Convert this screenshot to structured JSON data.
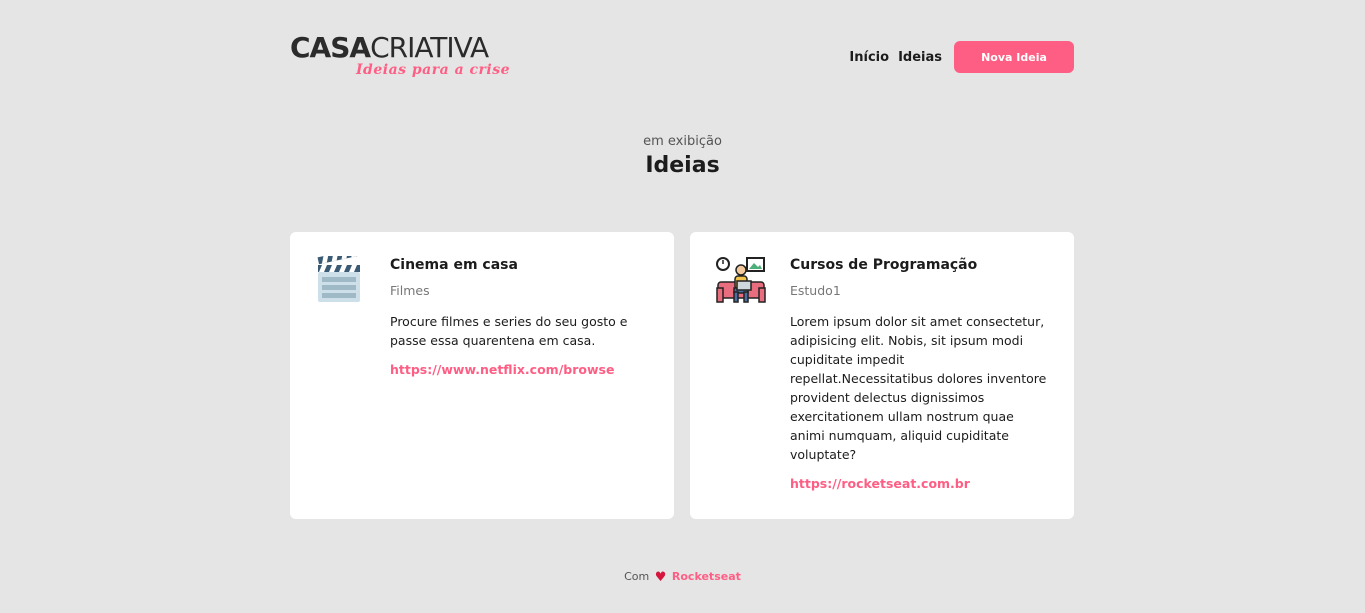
{
  "header": {
    "logo": {
      "main_bold": "CASA",
      "main_light": "CRIATIVA",
      "tagline": "Ideias para a crise"
    },
    "nav": {
      "items": [
        {
          "label": "Início"
        },
        {
          "label": "Ideias"
        }
      ],
      "button_label": "Nova Ideia"
    }
  },
  "section": {
    "subtitle": "em exibição",
    "title": "Ideias"
  },
  "cards": [
    {
      "icon": "film-clapperboard-icon",
      "title": "Cinema em casa",
      "category": "Filmes",
      "description": "Procure filmes e series do seu gosto e passe essa quarentena em casa.",
      "link": "https://www.netflix.com/browse"
    },
    {
      "icon": "person-studying-icon",
      "title": "Cursos de Programação",
      "category": "Estudo1",
      "description": "Lorem ipsum dolor sit amet consectetur, adipisicing elit. Nobis, sit ipsum modi cupiditate impedit repellat.Necessitatibus dolores inventore provident delectus dignissimos exercitationem ullam nostrum quae animi numquam, aliquid cupiditate voluptate?",
      "link": "https://rocketseat.com.br"
    }
  ],
  "footer": {
    "prefix": "Com",
    "heart_icon": "heart-icon",
    "brand": "Rocketseat"
  },
  "colors": {
    "accent": "#ff5e84",
    "background": "#e5e5e5",
    "card": "#ffffff",
    "text": "#1c1c1c"
  }
}
